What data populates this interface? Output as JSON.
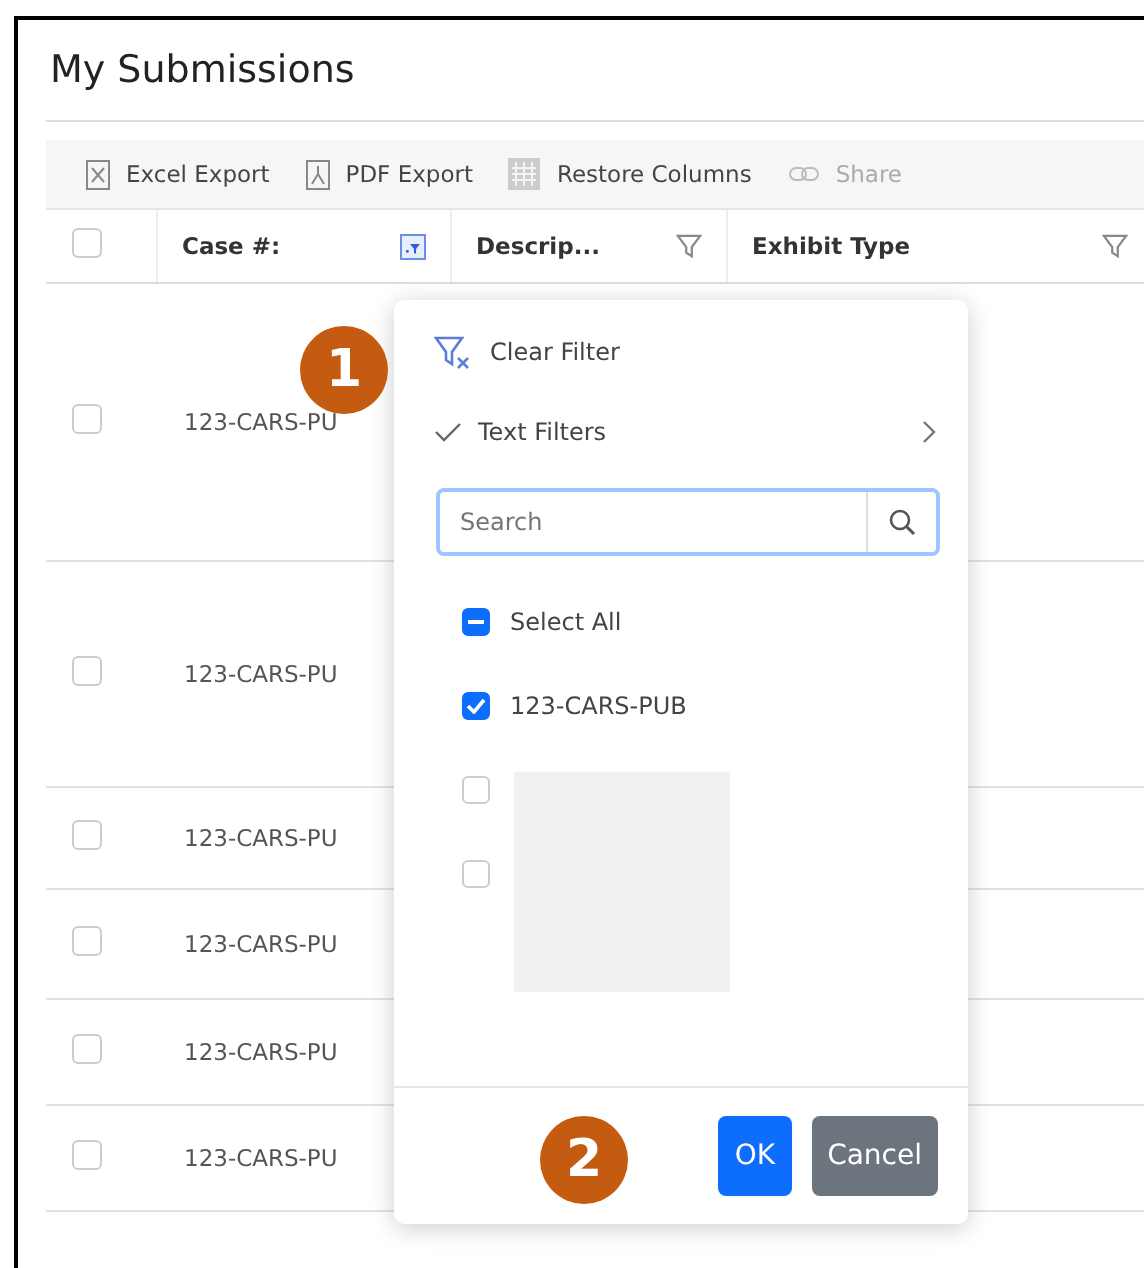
{
  "title": "My Submissions",
  "toolbar": [
    {
      "label": "Excel Export",
      "kind": "excel",
      "disabled": false
    },
    {
      "label": "PDF Export",
      "kind": "pdf",
      "disabled": false
    },
    {
      "label": "Restore Columns",
      "kind": "columns",
      "disabled": false
    },
    {
      "label": "Share",
      "kind": "link",
      "disabled": true
    }
  ],
  "table": {
    "header_checked": false,
    "columns": [
      {
        "label": "Case #:",
        "filtered": true
      },
      {
        "label": "Descrip...",
        "filtered": false
      },
      {
        "label": "Exhibit Type",
        "filtered": false
      }
    ],
    "rows": [
      {
        "case": "123-CARS-PU",
        "checked": false
      },
      {
        "case": "123-CARS-PU",
        "checked": false
      },
      {
        "case": "123-CARS-PU",
        "checked": false
      },
      {
        "case": "123-CARS-PU",
        "checked": false
      },
      {
        "case": "123-CARS-PU",
        "checked": false
      },
      {
        "case": "123-CARS-PU",
        "checked": false
      }
    ]
  },
  "filter_menu": {
    "clear": "Clear Filter",
    "text_filters": "Text Filters",
    "search": {
      "placeholder": "Search"
    },
    "options": [
      {
        "kind": "all",
        "label": "Select All",
        "indeterminate": true
      },
      {
        "kind": "item",
        "label": "123-CARS-PUB",
        "checked": true
      },
      {
        "kind": "redacted",
        "checked": false
      },
      {
        "kind": "redacted",
        "checked": false
      }
    ],
    "buttons": [
      {
        "label": "OK",
        "kind": "primary"
      },
      {
        "label": "Cancel",
        "kind": "secondary"
      }
    ]
  },
  "callouts": [
    "1",
    "2"
  ]
}
